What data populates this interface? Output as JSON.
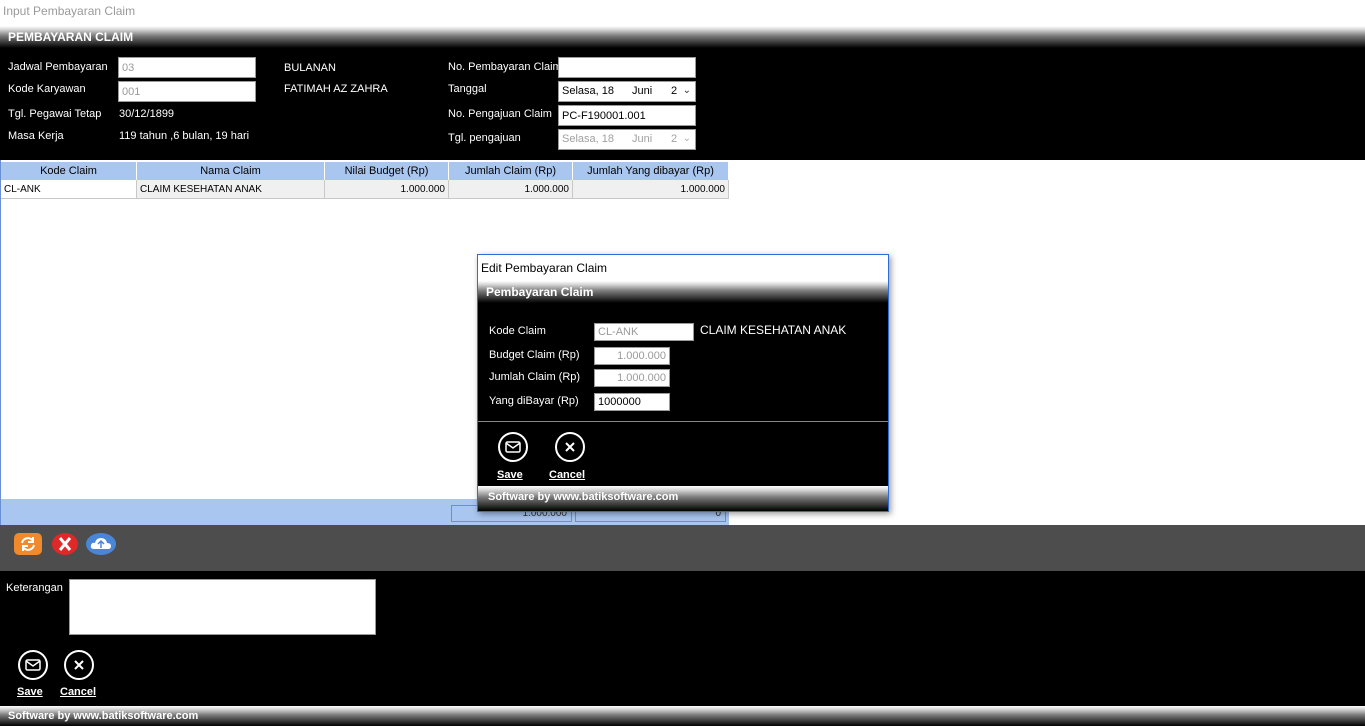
{
  "window": {
    "title": "Input Pembayaran Claim"
  },
  "main": {
    "header": "PEMBAYARAN CLAIM",
    "labels": {
      "jadwal": "Jadwal Pembayaran",
      "kode_karyawan": "Kode Karyawan",
      "tgl_pegawai": "Tgl. Pegawai Tetap",
      "masa_kerja": "Masa Kerja",
      "no_pembayaran": "No. Pembayaran Claim",
      "tanggal": "Tanggal",
      "no_pengajuan": "No. Pengajuan Claim",
      "tgl_pengajuan": "Tgl. pengajuan"
    },
    "values": {
      "jadwal": "03",
      "kode_karyawan": "001",
      "tgl_pegawai": "30/12/1899",
      "masa_kerja": "119 tahun ,6 bulan, 19 hari",
      "jadwal_desc": "BULANAN",
      "nama_karyawan": "FATIMAH AZ ZAHRA",
      "no_pembayaran": "",
      "tanggal": {
        "day": "Selasa, 18",
        "month": "Juni",
        "year": "2"
      },
      "no_pengajuan": "PC-F190001.001",
      "tgl_pengajuan": {
        "day": "Selasa, 18",
        "month": "Juni",
        "year": "2"
      }
    }
  },
  "grid": {
    "columns": [
      "Kode Claim",
      "Nama Claim",
      "Nilai Budget (Rp)",
      "Jumlah Claim (Rp)",
      "Jumlah Yang dibayar (Rp)"
    ],
    "rows": [
      {
        "kode": "CL-ANK",
        "nama": "CLAIM KESEHATAN ANAK",
        "budget": "1.000.000",
        "jumlah": "1.000.000",
        "dibayar": "1.000.000"
      }
    ],
    "footer": {
      "jumlah_total": "1.000.000",
      "dibayar_total": "0"
    }
  },
  "bottom": {
    "keterangan_label": "Keterangan",
    "keterangan_value": "",
    "save_label": "Save",
    "cancel_label": "Cancel"
  },
  "status": "Software by www.batiksoftware.com",
  "dialog": {
    "title": "Edit Pembayaran Claim",
    "header": "Pembayaran Claim",
    "labels": {
      "kode": "Kode Claim",
      "budget": "Budget Claim (Rp)",
      "jumlah": "Jumlah Claim (Rp)",
      "dibayar": "Yang diBayar (Rp)"
    },
    "values": {
      "kode": "CL-ANK",
      "nama": "CLAIM KESEHATAN ANAK",
      "budget": "1.000.000",
      "jumlah": "1.000.000",
      "dibayar": "1000000"
    },
    "save_label": "Save",
    "cancel_label": "Cancel",
    "status": "Software by www.batiksoftware.com"
  },
  "colors": {
    "grid_header": "#a9c6f0",
    "panel": "#000000",
    "toolbar": "#4d4d4d",
    "refresh": "#f08a2c",
    "delete": "#e02828",
    "upload": "#4a86d8"
  }
}
